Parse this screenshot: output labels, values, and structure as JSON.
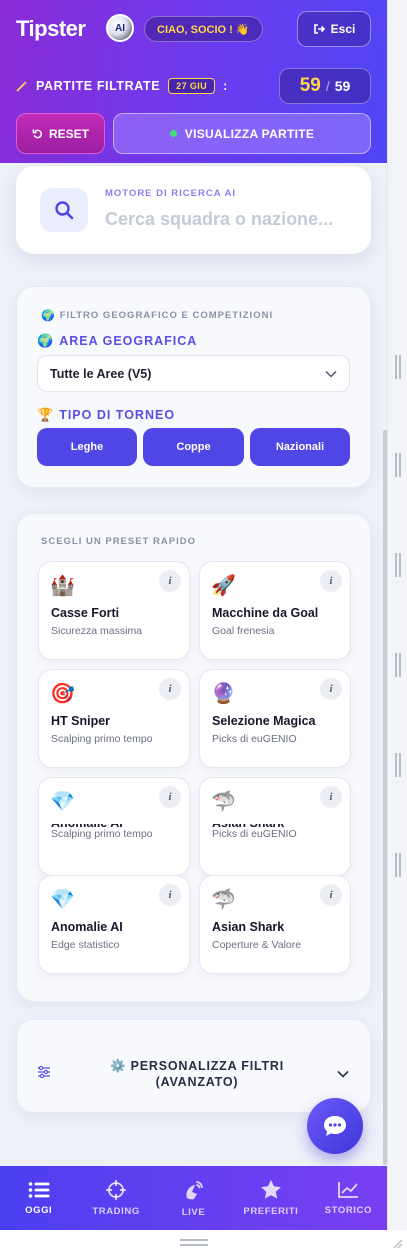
{
  "header": {
    "brand": "Tipster",
    "badge": "AI",
    "greeting": "CIAO, SOCIO ! 👋",
    "logout_label": "Esci",
    "filter_label": "PARTITE FILTRATE",
    "date_chip": "27 GIU",
    "filter_colon": ":",
    "count_filtered": "59",
    "count_separator": "/",
    "count_total": "59",
    "reset_label": "RESET",
    "view_label": "VISUALIZZA PARTITE"
  },
  "search": {
    "label": "MOTORE DI RICERCA AI",
    "placeholder": "Cerca squadra o nazione..."
  },
  "geo": {
    "title": "FILTRO GEOGRAFICO E COMPETIZIONI",
    "area_label": "AREA GEOGRAFICA",
    "area_value": "Tutte le Aree (V5)",
    "tournament_label": "TIPO DI TORNEO",
    "tournament_buttons": [
      "Leghe",
      "Coppe",
      "Nazionali"
    ]
  },
  "presets": {
    "title": "SCEGLI UN PRESET RAPIDO",
    "tiles": [
      {
        "emoji": "🏰",
        "title": "Casse Forti",
        "subtitle": "Sicurezza massima"
      },
      {
        "emoji": "🚀",
        "title": "Macchine da Goal",
        "subtitle": "Goal frenesia"
      },
      {
        "emoji": "🎯",
        "title": "HT Sniper",
        "subtitle": "Scalping primo tempo"
      },
      {
        "emoji": "🔮",
        "title": "Selezione Magica",
        "subtitle": "Picks di euGENIO"
      },
      {
        "emoji": "💎",
        "title": "Anomalie AI",
        "subtitle": "Scalping primo tempo"
      },
      {
        "emoji": "🦈",
        "title": "Asian Shark",
        "subtitle": "Picks di euGENIO"
      },
      {
        "emoji": "💎",
        "title": "Anomalie AI",
        "subtitle": "Edge statistico"
      },
      {
        "emoji": "🦈",
        "title": "Asian Shark",
        "subtitle": "Coperture & Valore"
      }
    ],
    "info_label": "i"
  },
  "advanced": {
    "label_line1": "⚙️ PERSONALIZZA FILTRI",
    "label_line2": "(AVANZATO)"
  },
  "nav": {
    "items": [
      {
        "label": "OGGI",
        "icon": "list-icon",
        "active": true
      },
      {
        "label": "TRADING",
        "icon": "crosshair-icon",
        "active": false
      },
      {
        "label": "LIVE",
        "icon": "satellite-icon",
        "active": false
      },
      {
        "label": "PREFERITI",
        "icon": "star-icon",
        "active": false
      },
      {
        "label": "STORICO",
        "icon": "chart-line-icon",
        "active": false
      }
    ]
  },
  "colors": {
    "accent": "#4f46e5",
    "header_gradient_start": "#8a2bd6",
    "header_gradient_end": "#4f46f5",
    "highlight": "#ffd54a"
  }
}
